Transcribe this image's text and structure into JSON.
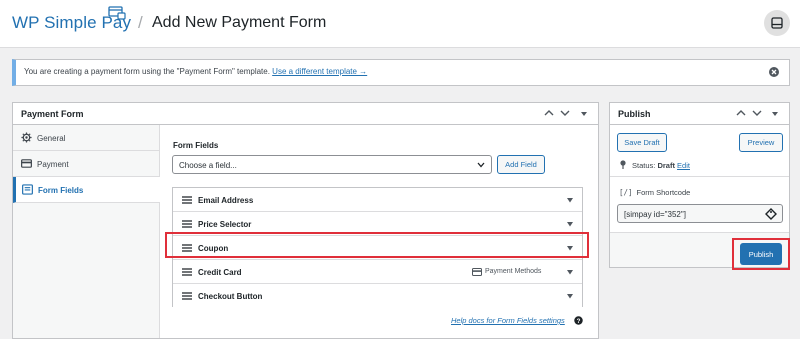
{
  "header": {
    "logo": "WP Simple Pay",
    "separator": "/",
    "page_title": "Add New Payment Form"
  },
  "notice": {
    "text_before": "You are creating a payment form using the \"Payment Form\" template. ",
    "link": "Use a different template →"
  },
  "payment_form": {
    "title": "Payment Form",
    "tabs": [
      {
        "label": "General",
        "icon": "gear-icon"
      },
      {
        "label": "Payment",
        "icon": "credit-card-icon"
      },
      {
        "label": "Form Fields",
        "icon": "form-icon",
        "active": true
      }
    ],
    "form_fields_label": "Form Fields",
    "select_placeholder": "Choose a field...",
    "add_field_label": "Add Field",
    "fields": [
      {
        "label": "Email Address"
      },
      {
        "label": "Price Selector"
      },
      {
        "label": "Coupon"
      },
      {
        "label": "Credit Card",
        "extra": "Payment Methods"
      },
      {
        "label": "Checkout Button"
      }
    ],
    "help_link": "Help docs for Form Fields settings"
  },
  "publish": {
    "title": "Publish",
    "save_draft": "Save Draft",
    "preview": "Preview",
    "status_label": "Status: ",
    "status_value": "Draft",
    "edit_link": "Edit",
    "shortcode_icon": "[/]",
    "shortcode_label": "Form Shortcode",
    "shortcode_value": "[simpay id=\"352\"]",
    "publish_button": "Publish"
  },
  "colors": {
    "accent": "#2271b1",
    "highlight": "#e02f3a",
    "notice_border": "#72aee6"
  }
}
